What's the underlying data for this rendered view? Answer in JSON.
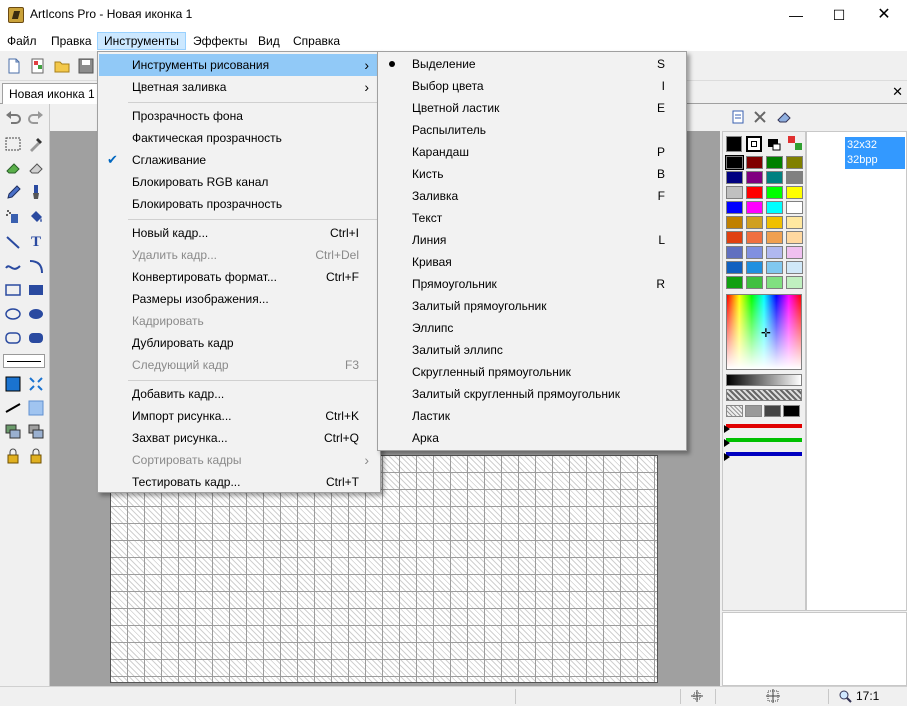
{
  "window": {
    "title": "ArtIcons Pro - Новая иконка 1"
  },
  "menubar": [
    "Файл",
    "Правка",
    "Инструменты",
    "Эффекты",
    "Вид",
    "Справка"
  ],
  "tab": {
    "label": "Новая иконка 1"
  },
  "frames": {
    "size": "32x32",
    "depth": "32bpp"
  },
  "status": {
    "zoom": "17:1"
  },
  "tools_menu": [
    {
      "label": "Инструменты рисования",
      "shortcut": "",
      "submenu": true,
      "highlight": true
    },
    {
      "label": "Цветная заливка",
      "shortcut": "",
      "submenu": true
    },
    {
      "sep": true
    },
    {
      "label": "Прозрачность фона",
      "shortcut": ""
    },
    {
      "label": "Фактическая прозрачность",
      "shortcut": ""
    },
    {
      "label": "Сглаживание",
      "shortcut": "",
      "checked": true
    },
    {
      "label": "Блокировать RGB канал",
      "shortcut": ""
    },
    {
      "label": "Блокировать прозрачность",
      "shortcut": ""
    },
    {
      "sep": true
    },
    {
      "label": "Новый кадр...",
      "shortcut": "Ctrl+I"
    },
    {
      "label": "Удалить кадр...",
      "shortcut": "Ctrl+Del",
      "disabled": true
    },
    {
      "label": "Конвертировать формат...",
      "shortcut": "Ctrl+F"
    },
    {
      "label": "Размеры изображения...",
      "shortcut": ""
    },
    {
      "label": "Кадрировать",
      "shortcut": "",
      "disabled": true
    },
    {
      "label": "Дублировать кадр",
      "shortcut": ""
    },
    {
      "label": "Следующий кадр",
      "shortcut": "F3",
      "disabled": true
    },
    {
      "sep": true
    },
    {
      "label": "Добавить кадр...",
      "shortcut": ""
    },
    {
      "label": "Импорт рисунка...",
      "shortcut": "Ctrl+K"
    },
    {
      "label": "Захват рисунка...",
      "shortcut": "Ctrl+Q"
    },
    {
      "label": "Сортировать кадры",
      "shortcut": "",
      "submenu": true,
      "disabled": true
    },
    {
      "label": "Тестировать кадр...",
      "shortcut": "Ctrl+T"
    }
  ],
  "draw_menu": [
    {
      "label": "Выделение",
      "shortcut": "S",
      "selected": true
    },
    {
      "label": "Выбор цвета",
      "shortcut": "I"
    },
    {
      "label": "Цветной ластик",
      "shortcut": "E"
    },
    {
      "label": "Распылитель",
      "shortcut": ""
    },
    {
      "label": "Карандаш",
      "shortcut": "P"
    },
    {
      "label": "Кисть",
      "shortcut": "B"
    },
    {
      "label": "Заливка",
      "shortcut": "F"
    },
    {
      "label": "Текст",
      "shortcut": ""
    },
    {
      "label": "Линия",
      "shortcut": "L"
    },
    {
      "label": "Кривая",
      "shortcut": ""
    },
    {
      "label": "Прямоугольник",
      "shortcut": "R"
    },
    {
      "label": "Залитый прямоугольник",
      "shortcut": ""
    },
    {
      "label": "Эллипс",
      "shortcut": ""
    },
    {
      "label": "Залитый эллипс",
      "shortcut": ""
    },
    {
      "label": "Скругленный прямоугольник",
      "shortcut": ""
    },
    {
      "label": "Залитый скругленный прямоугольник",
      "shortcut": ""
    },
    {
      "label": "Ластик",
      "shortcut": ""
    },
    {
      "label": "Арка",
      "shortcut": ""
    }
  ],
  "palette": [
    "#000000",
    "#800000",
    "#008000",
    "#808000",
    "#000080",
    "#800080",
    "#008080",
    "#808080",
    "#c0c0c0",
    "#ff0000",
    "#00ff00",
    "#ffff00",
    "#0000ff",
    "#ff00ff",
    "#00ffff",
    "#ffffff",
    "#c08000",
    "#d0a020",
    "#f0c000",
    "#ffe8a0",
    "#e04010",
    "#f07040",
    "#f0a050",
    "#ffd8a0",
    "#6070c0",
    "#8090e0",
    "#b0b8f0",
    "#f0c0f0",
    "#1060c0",
    "#2090e0",
    "#80c8f0",
    "#d0e8f8",
    "#10a010",
    "#40c040",
    "#80e080",
    "#c0f0c0"
  ]
}
